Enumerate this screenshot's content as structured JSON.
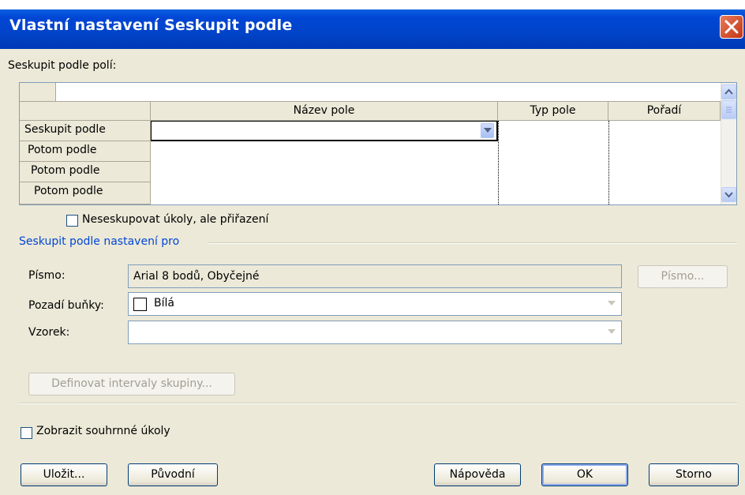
{
  "window": {
    "title": "Vlastní nastavení Seskupit podle"
  },
  "grid": {
    "section_label": "Seskupit podle polí:",
    "columns": {
      "field_name": "Název pole",
      "field_type": "Typ pole",
      "order": "Pořadí"
    },
    "rows": [
      {
        "label": "Seskupit podle",
        "field_name": "",
        "field_type": "",
        "order": ""
      },
      {
        "label": "Potom podle",
        "field_name": "",
        "field_type": "",
        "order": ""
      },
      {
        "label": "Potom podle",
        "field_name": "",
        "field_type": "",
        "order": ""
      },
      {
        "label": "Potom podle",
        "field_name": "",
        "field_type": "",
        "order": ""
      }
    ]
  },
  "assignments_checkbox": {
    "label": "Neseskupovat úkoly, ale přiřazení",
    "checked": false
  },
  "settings_group": {
    "title": "Seskupit podle nastavení pro",
    "font_label": "Písmo:",
    "font_value": "Arial 8 bodů, Obyčejné",
    "font_button": "Písmo...",
    "cell_bg_label": "Pozadí buňky:",
    "cell_bg_value": "Bílá",
    "pattern_label": "Vzorek:",
    "pattern_value": "",
    "define_intervals_button": "Definovat intervaly skupiny..."
  },
  "summary_checkbox": {
    "label": "Zobrazit souhrnné úkoly",
    "checked": false
  },
  "buttons": {
    "save": "Uložit...",
    "reset": "Původní",
    "help": "Nápověda",
    "ok": "OK",
    "cancel": "Storno"
  },
  "colors": {
    "title_bar": "#0046d5",
    "dialog_bg": "#ece9d8",
    "group_title": "#0046d5",
    "close_button": "#c33515"
  }
}
